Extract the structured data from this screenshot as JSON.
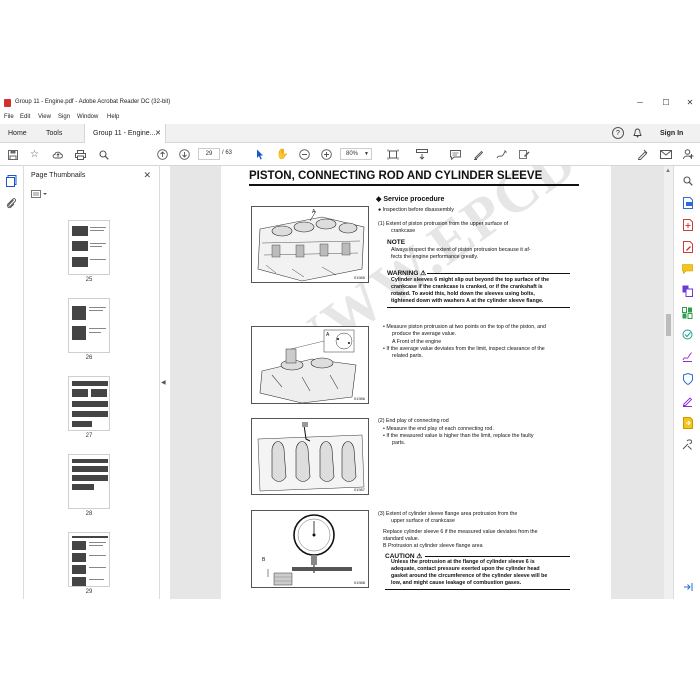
{
  "window": {
    "title": "Group 11 - Engine.pdf - Adobe Acrobat Reader DC (32-bit)",
    "minimize": "─",
    "maximize": "☐",
    "close": "✕"
  },
  "menu": [
    "File",
    "Edit",
    "View",
    "Sign",
    "Window",
    "Help"
  ],
  "tabs": {
    "home": "Home",
    "tools": "Tools",
    "document": "Group 11 - Engine....",
    "sign_in": "Sign In",
    "help_icon": "?",
    "bell_icon": "🔔"
  },
  "toolbar": {
    "current_page": "29",
    "total_pages": "/  63",
    "zoom": "80%"
  },
  "thumbnails": {
    "title": "Page Thumbnails",
    "pages": [
      "25",
      "26",
      "27",
      "28",
      "29"
    ]
  },
  "page": {
    "title": "PISTON, CONNECTING ROD AND CYLINDER SLEEVE",
    "section": "◆ Service procedure",
    "bullet_intro": "● Inspection before disassembly",
    "item1_title": "(1)   Extent of piston protrusion from the upper surface of",
    "item1_title2": "crankcase",
    "note_label": "NOTE",
    "note_text1": "Always inspect the extent of piston protrusion because it af-",
    "note_text2": "fects the engine performance greatly.",
    "warning_label": "WARNING ⚠",
    "warning_lines": [
      "Cylinder sleeves 6 might slip out beyond the top surface of the",
      "crankcase if the crankcase is cranked, or if the crankshaft is",
      "rotated. To avoid this, hold down the sleeves using bolts,",
      "tightened down with washers A at the cylinder sleeve flange."
    ],
    "measure_lines": [
      "•  Measure piston protrusion at two points on the top of the piston, and",
      "produce the average value.",
      "A   Front of the engine",
      "•  If the average value deviates from the limit, inspect clearance of the",
      "related parts."
    ],
    "item2_title": "(2)   End play of connecting rod",
    "item2_lines": [
      "•  Measure the end play of each connecting rod.",
      "•  If the measured value is higher than the limit, replace the faulty",
      "parts."
    ],
    "item3_title": "(3)   Extent of cylinder sleeve flange area protrusion from the",
    "item3_title2": "upper surface of crankcase",
    "item3_lines": [
      "Replace cylinder sleeve 6 if the measured value deviates from the",
      "standard value.",
      "B      Protrusion at cylinder sleeve flange area"
    ],
    "caution_label": "CAUTION ⚠",
    "caution_lines": [
      "Unless the protrusion at the flange of cylinder sleeve 6 is",
      "adequate, contact pressure exerted upon the cylinder head",
      "gasket around the circumference of the cylinder sleeve will be",
      "low, and might cause leakage of combustion gases."
    ],
    "fig_codes": [
      "01985",
      "01986",
      "01987",
      "01988"
    ],
    "fig_label_a": "A",
    "fig_label_a2": "A",
    "fig_label_b": "B",
    "watermark": "WWW.EPCDOC.COM"
  }
}
